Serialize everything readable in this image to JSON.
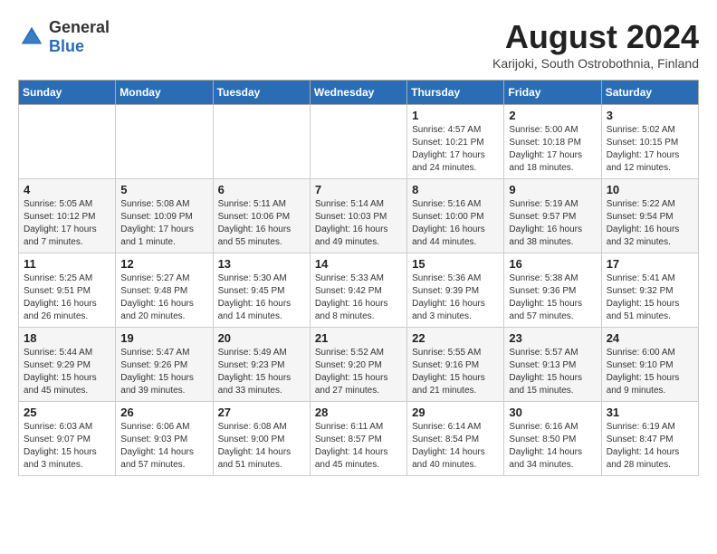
{
  "header": {
    "logo_general": "General",
    "logo_blue": "Blue",
    "month_year": "August 2024",
    "location": "Karijoki, South Ostrobothnia, Finland"
  },
  "weekdays": [
    "Sunday",
    "Monday",
    "Tuesday",
    "Wednesday",
    "Thursday",
    "Friday",
    "Saturday"
  ],
  "weeks": [
    [
      {
        "day": "",
        "info": ""
      },
      {
        "day": "",
        "info": ""
      },
      {
        "day": "",
        "info": ""
      },
      {
        "day": "",
        "info": ""
      },
      {
        "day": "1",
        "info": "Sunrise: 4:57 AM\nSunset: 10:21 PM\nDaylight: 17 hours\nand 24 minutes."
      },
      {
        "day": "2",
        "info": "Sunrise: 5:00 AM\nSunset: 10:18 PM\nDaylight: 17 hours\nand 18 minutes."
      },
      {
        "day": "3",
        "info": "Sunrise: 5:02 AM\nSunset: 10:15 PM\nDaylight: 17 hours\nand 12 minutes."
      }
    ],
    [
      {
        "day": "4",
        "info": "Sunrise: 5:05 AM\nSunset: 10:12 PM\nDaylight: 17 hours\nand 7 minutes."
      },
      {
        "day": "5",
        "info": "Sunrise: 5:08 AM\nSunset: 10:09 PM\nDaylight: 17 hours\nand 1 minute."
      },
      {
        "day": "6",
        "info": "Sunrise: 5:11 AM\nSunset: 10:06 PM\nDaylight: 16 hours\nand 55 minutes."
      },
      {
        "day": "7",
        "info": "Sunrise: 5:14 AM\nSunset: 10:03 PM\nDaylight: 16 hours\nand 49 minutes."
      },
      {
        "day": "8",
        "info": "Sunrise: 5:16 AM\nSunset: 10:00 PM\nDaylight: 16 hours\nand 44 minutes."
      },
      {
        "day": "9",
        "info": "Sunrise: 5:19 AM\nSunset: 9:57 PM\nDaylight: 16 hours\nand 38 minutes."
      },
      {
        "day": "10",
        "info": "Sunrise: 5:22 AM\nSunset: 9:54 PM\nDaylight: 16 hours\nand 32 minutes."
      }
    ],
    [
      {
        "day": "11",
        "info": "Sunrise: 5:25 AM\nSunset: 9:51 PM\nDaylight: 16 hours\nand 26 minutes."
      },
      {
        "day": "12",
        "info": "Sunrise: 5:27 AM\nSunset: 9:48 PM\nDaylight: 16 hours\nand 20 minutes."
      },
      {
        "day": "13",
        "info": "Sunrise: 5:30 AM\nSunset: 9:45 PM\nDaylight: 16 hours\nand 14 minutes."
      },
      {
        "day": "14",
        "info": "Sunrise: 5:33 AM\nSunset: 9:42 PM\nDaylight: 16 hours\nand 8 minutes."
      },
      {
        "day": "15",
        "info": "Sunrise: 5:36 AM\nSunset: 9:39 PM\nDaylight: 16 hours\nand 3 minutes."
      },
      {
        "day": "16",
        "info": "Sunrise: 5:38 AM\nSunset: 9:36 PM\nDaylight: 15 hours\nand 57 minutes."
      },
      {
        "day": "17",
        "info": "Sunrise: 5:41 AM\nSunset: 9:32 PM\nDaylight: 15 hours\nand 51 minutes."
      }
    ],
    [
      {
        "day": "18",
        "info": "Sunrise: 5:44 AM\nSunset: 9:29 PM\nDaylight: 15 hours\nand 45 minutes."
      },
      {
        "day": "19",
        "info": "Sunrise: 5:47 AM\nSunset: 9:26 PM\nDaylight: 15 hours\nand 39 minutes."
      },
      {
        "day": "20",
        "info": "Sunrise: 5:49 AM\nSunset: 9:23 PM\nDaylight: 15 hours\nand 33 minutes."
      },
      {
        "day": "21",
        "info": "Sunrise: 5:52 AM\nSunset: 9:20 PM\nDaylight: 15 hours\nand 27 minutes."
      },
      {
        "day": "22",
        "info": "Sunrise: 5:55 AM\nSunset: 9:16 PM\nDaylight: 15 hours\nand 21 minutes."
      },
      {
        "day": "23",
        "info": "Sunrise: 5:57 AM\nSunset: 9:13 PM\nDaylight: 15 hours\nand 15 minutes."
      },
      {
        "day": "24",
        "info": "Sunrise: 6:00 AM\nSunset: 9:10 PM\nDaylight: 15 hours\nand 9 minutes."
      }
    ],
    [
      {
        "day": "25",
        "info": "Sunrise: 6:03 AM\nSunset: 9:07 PM\nDaylight: 15 hours\nand 3 minutes."
      },
      {
        "day": "26",
        "info": "Sunrise: 6:06 AM\nSunset: 9:03 PM\nDaylight: 14 hours\nand 57 minutes."
      },
      {
        "day": "27",
        "info": "Sunrise: 6:08 AM\nSunset: 9:00 PM\nDaylight: 14 hours\nand 51 minutes."
      },
      {
        "day": "28",
        "info": "Sunrise: 6:11 AM\nSunset: 8:57 PM\nDaylight: 14 hours\nand 45 minutes."
      },
      {
        "day": "29",
        "info": "Sunrise: 6:14 AM\nSunset: 8:54 PM\nDaylight: 14 hours\nand 40 minutes."
      },
      {
        "day": "30",
        "info": "Sunrise: 6:16 AM\nSunset: 8:50 PM\nDaylight: 14 hours\nand 34 minutes."
      },
      {
        "day": "31",
        "info": "Sunrise: 6:19 AM\nSunset: 8:47 PM\nDaylight: 14 hours\nand 28 minutes."
      }
    ]
  ]
}
